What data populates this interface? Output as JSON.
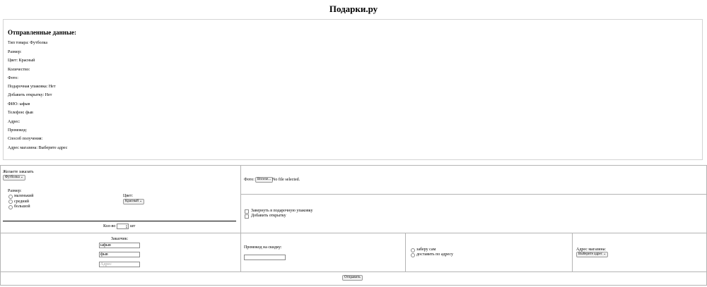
{
  "header": {
    "title": "Подарки.ру"
  },
  "sent": {
    "heading": "Отправленные данные:",
    "lines": [
      "Тип товара: Футболка",
      "Размер:",
      "Цвет: Красный",
      "Количество:",
      "Фото:",
      "Подарочная упаковка: Нет",
      "Добавить открытку: Нет",
      "ФИО: ыфыв",
      "Телефон: фыв",
      "Адрес:",
      "Промокод:",
      "Способ получения:",
      "Адрес магазина: Выберите адрес"
    ]
  },
  "order": {
    "product_label": "Желаете заказать",
    "product_value": "Футболка",
    "size_label": "Размер:",
    "sizes": [
      "маленький",
      "средний",
      "большой"
    ],
    "color_label": "Цвет:",
    "color_value": "Красный",
    "qty_label": "Кол-во",
    "qty_value": "",
    "qty_unit": "шт"
  },
  "photo": {
    "label": "Фото:",
    "browse_label": "Browse...",
    "file_status": "No file selected."
  },
  "extras": {
    "wrap_label": "Завернуть в подарочную упаковку",
    "card_label": "Добавить открытку"
  },
  "customer": {
    "label": "Заказчик:",
    "name_value": "ыфыв",
    "phone_value": "фыв",
    "address_placeholder": "Адрес"
  },
  "promo": {
    "label": "Промокод на скидку:",
    "value": ""
  },
  "delivery": {
    "options": [
      "заберу сам",
      "доставить по адресу"
    ]
  },
  "store": {
    "label": "Адрес магазина:",
    "value": "Выберите адрес"
  },
  "submit": {
    "label": "Отправить"
  },
  "icons": {
    "dropdown": "chevron-down-icon",
    "spinner": "spinner-arrows-icon"
  }
}
